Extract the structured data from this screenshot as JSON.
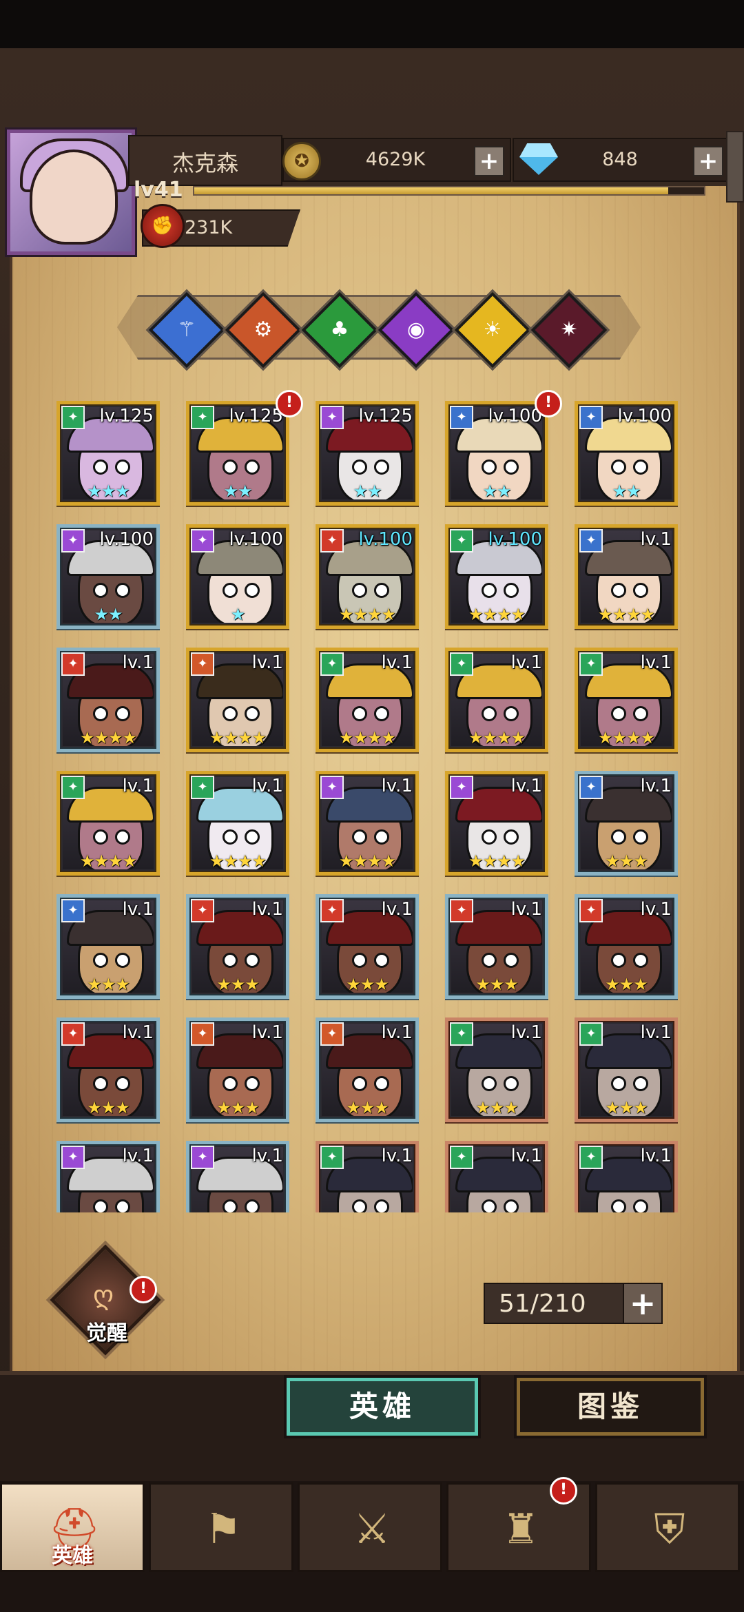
{
  "player": {
    "name": "杰克森",
    "level": "lv41",
    "xp_progress": 0.93,
    "power": "231K"
  },
  "resources": {
    "gold": "4629K",
    "gems": "848"
  },
  "factions": [
    {
      "icon": "water-staff-icon",
      "color": "#3c6fd2"
    },
    {
      "icon": "fire-gear-icon",
      "color": "#c9562a"
    },
    {
      "icon": "nature-clover-icon",
      "color": "#2b9a3c"
    },
    {
      "icon": "shadow-eye-icon",
      "color": "#8a3cc4"
    },
    {
      "icon": "light-eye-icon",
      "color": "#e5b720"
    },
    {
      "icon": "dark-spider-icon",
      "color": "#5a1a2a"
    }
  ],
  "heroes": [
    {
      "level": "lv.125",
      "stars": "★★★",
      "star_color": "cyan",
      "frame": "gold",
      "class_color": "#2aa55a",
      "skin": "#d9b8e0",
      "hat": "#b592c9",
      "alert": false
    },
    {
      "level": "lv.125",
      "stars": "★★",
      "star_color": "cyan",
      "frame": "gold",
      "class_color": "#2aa55a",
      "skin": "#b07a8a",
      "hat": "#e0b23a",
      "alert": true
    },
    {
      "level": "lv.125",
      "stars": "★★",
      "star_color": "cyan",
      "frame": "gold",
      "class_color": "#9a4ad4",
      "skin": "#e9e6e6",
      "hat": "#7c1a22",
      "alert": false
    },
    {
      "level": "lv.100",
      "stars": "★★",
      "star_color": "cyan",
      "frame": "gold",
      "class_color": "#3a72cc",
      "skin": "#f1d7c2",
      "hat": "#e9d9b8",
      "alert": true
    },
    {
      "level": "lv.100",
      "stars": "★★",
      "star_color": "cyan",
      "frame": "gold",
      "class_color": "#3a72cc",
      "skin": "#f1d7c2",
      "hat": "#f0d890",
      "alert": false
    },
    {
      "level": "lv.100",
      "stars": "★★",
      "star_color": "cyan",
      "frame": "blue",
      "class_color": "#9a4ad4",
      "skin": "#6a4a42",
      "hat": "#cfcfcf",
      "alert": false
    },
    {
      "level": "lv.100",
      "stars": "★",
      "star_color": "cyan",
      "frame": "gold",
      "class_color": "#9a4ad4",
      "skin": "#f0dfd5",
      "hat": "#8d8878",
      "alert": false
    },
    {
      "level": "lv.100",
      "stars": "★★★★",
      "star_color": "gold",
      "frame": "gold",
      "class_color": "#d23a2a",
      "skin": "#c9c6b5",
      "hat": "#a8a08a",
      "alert": false,
      "level_color": "cyan"
    },
    {
      "level": "lv.100",
      "stars": "★★★★",
      "star_color": "gold",
      "frame": "gold",
      "class_color": "#2aa55a",
      "skin": "#e8e0ea",
      "hat": "#c9c9d2",
      "alert": false,
      "level_color": "cyan"
    },
    {
      "level": "lv.1",
      "stars": "★★★★",
      "star_color": "gold",
      "frame": "gold",
      "class_color": "#3a72cc",
      "skin": "#f1d7c2",
      "hat": "#6a5a50",
      "alert": false
    },
    {
      "level": "lv.1",
      "stars": "★★★★",
      "star_color": "gold",
      "frame": "blue",
      "class_color": "#d23a2a",
      "skin": "#a86a52",
      "hat": "#4a1a1a",
      "alert": false
    },
    {
      "level": "lv.1",
      "stars": "★★★★",
      "star_color": "gold",
      "frame": "gold",
      "class_color": "#d2582a",
      "skin": "#e0c8b0",
      "hat": "#3a2c1c",
      "alert": false
    },
    {
      "level": "lv.1",
      "stars": "★★★★",
      "star_color": "gold",
      "frame": "gold",
      "class_color": "#2aa55a",
      "skin": "#b07a8a",
      "hat": "#e0b23a",
      "alert": false
    },
    {
      "level": "lv.1",
      "stars": "★★★★",
      "star_color": "gold",
      "frame": "gold",
      "class_color": "#2aa55a",
      "skin": "#b07a8a",
      "hat": "#e0b23a",
      "alert": false
    },
    {
      "level": "lv.1",
      "stars": "★★★★",
      "star_color": "gold",
      "frame": "gold",
      "class_color": "#2aa55a",
      "skin": "#b07a8a",
      "hat": "#e0b23a",
      "alert": false
    },
    {
      "level": "lv.1",
      "stars": "★★★★",
      "star_color": "gold",
      "frame": "gold",
      "class_color": "#2aa55a",
      "skin": "#b07a8a",
      "hat": "#e0b23a",
      "alert": false
    },
    {
      "level": "lv.1",
      "stars": "★★★★",
      "star_color": "gold",
      "frame": "gold",
      "class_color": "#2aa55a",
      "skin": "#f0eaf0",
      "hat": "#9ad0e0",
      "alert": false
    },
    {
      "level": "lv.1",
      "stars": "★★★★",
      "star_color": "gold",
      "frame": "gold",
      "class_color": "#9a4ad4",
      "skin": "#b07a6a",
      "hat": "#3a4a6a",
      "alert": false
    },
    {
      "level": "lv.1",
      "stars": "★★★★",
      "star_color": "gold",
      "frame": "gold",
      "class_color": "#9a4ad4",
      "skin": "#e9e6e6",
      "hat": "#7c1a22",
      "alert": false
    },
    {
      "level": "lv.1",
      "stars": "★★★",
      "star_color": "gold",
      "frame": "blue",
      "class_color": "#3a72cc",
      "skin": "#c9a070",
      "hat": "#3a3030",
      "alert": false
    },
    {
      "level": "lv.1",
      "stars": "★★★",
      "star_color": "gold",
      "frame": "blue",
      "class_color": "#3a72cc",
      "skin": "#c9a070",
      "hat": "#3a3030",
      "alert": false
    },
    {
      "level": "lv.1",
      "stars": "★★★",
      "star_color": "gold",
      "frame": "blue",
      "class_color": "#d23a2a",
      "skin": "#7a4a3a",
      "hat": "#6a1a1a",
      "alert": false
    },
    {
      "level": "lv.1",
      "stars": "★★★",
      "star_color": "gold",
      "frame": "blue",
      "class_color": "#d23a2a",
      "skin": "#7a4a3a",
      "hat": "#6a1a1a",
      "alert": false
    },
    {
      "level": "lv.1",
      "stars": "★★★",
      "star_color": "gold",
      "frame": "blue",
      "class_color": "#d23a2a",
      "skin": "#7a4a3a",
      "hat": "#6a1a1a",
      "alert": false
    },
    {
      "level": "lv.1",
      "stars": "★★★",
      "star_color": "gold",
      "frame": "blue",
      "class_color": "#d23a2a",
      "skin": "#7a4a3a",
      "hat": "#6a1a1a",
      "alert": false
    },
    {
      "level": "lv.1",
      "stars": "★★★",
      "star_color": "gold",
      "frame": "blue",
      "class_color": "#d23a2a",
      "skin": "#7a4a3a",
      "hat": "#6a1a1a",
      "alert": false
    },
    {
      "level": "lv.1",
      "stars": "★★★",
      "star_color": "gold",
      "frame": "blue",
      "class_color": "#d2582a",
      "skin": "#a86a52",
      "hat": "#4a1a1a",
      "alert": false
    },
    {
      "level": "lv.1",
      "stars": "★★★",
      "star_color": "gold",
      "frame": "blue",
      "class_color": "#d2582a",
      "skin": "#a86a52",
      "hat": "#4a1a1a",
      "alert": false
    },
    {
      "level": "lv.1",
      "stars": "★★★",
      "star_color": "gold",
      "frame": "bronze",
      "class_color": "#2aa55a",
      "skin": "#b8a8a0",
      "hat": "#2a2a3a",
      "alert": false
    },
    {
      "level": "lv.1",
      "stars": "★★★",
      "star_color": "gold",
      "frame": "bronze",
      "class_color": "#2aa55a",
      "skin": "#b8a8a0",
      "hat": "#2a2a3a",
      "alert": false
    },
    {
      "level": "lv.1",
      "stars": "",
      "star_color": "gold",
      "frame": "blue",
      "class_color": "#9a4ad4",
      "skin": "#6a4a42",
      "hat": "#cfcfcf",
      "alert": false
    },
    {
      "level": "lv.1",
      "stars": "",
      "star_color": "gold",
      "frame": "blue",
      "class_color": "#9a4ad4",
      "skin": "#6a4a42",
      "hat": "#cfcfcf",
      "alert": false
    },
    {
      "level": "lv.1",
      "stars": "",
      "star_color": "gold",
      "frame": "bronze",
      "class_color": "#2aa55a",
      "skin": "#b8a8a0",
      "hat": "#2a2a3a",
      "alert": false
    },
    {
      "level": "lv.1",
      "stars": "",
      "star_color": "gold",
      "frame": "bronze",
      "class_color": "#2aa55a",
      "skin": "#b8a8a0",
      "hat": "#2a2a3a",
      "alert": false
    },
    {
      "level": "lv.1",
      "stars": "",
      "star_color": "gold",
      "frame": "bronze",
      "class_color": "#2aa55a",
      "skin": "#b8a8a0",
      "hat": "#2a2a3a",
      "alert": false
    }
  ],
  "awaken": {
    "label": "觉醒",
    "alert": "!"
  },
  "hero_count": "51/210",
  "alert_mark": "!",
  "tabs": {
    "heroes": "英雄",
    "codex": "图鉴"
  },
  "nav": [
    {
      "label": "英雄",
      "icon": "helmet-icon",
      "glyph": "⛑"
    },
    {
      "label": "",
      "icon": "flag-wheel-icon",
      "glyph": "⚑"
    },
    {
      "label": "",
      "icon": "crossed-swords-icon",
      "glyph": "⚔"
    },
    {
      "label": "",
      "icon": "castle-icon",
      "glyph": "♜",
      "alert": "!"
    },
    {
      "label": "",
      "icon": "alliance-emblem-icon",
      "glyph": "⛨"
    }
  ]
}
